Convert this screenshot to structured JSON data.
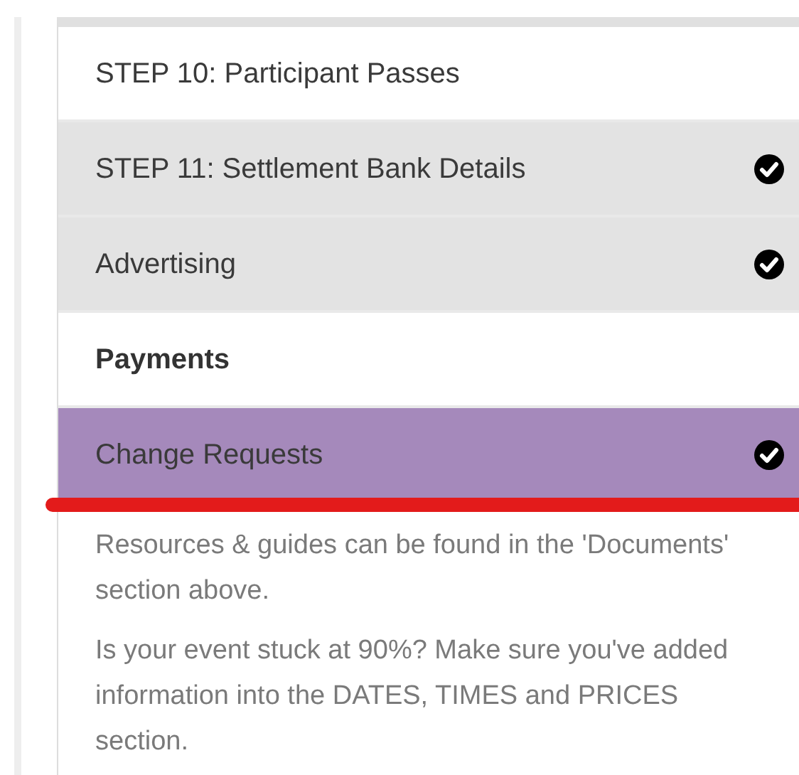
{
  "steps": [
    {
      "label": "STEP 10: Participant Passes",
      "kind": "step",
      "completed": false,
      "selected": false
    },
    {
      "label": "STEP 11: Settlement Bank Details",
      "kind": "step",
      "completed": true,
      "selected": false
    },
    {
      "label": "Advertising",
      "kind": "step",
      "completed": true,
      "selected": false
    },
    {
      "label": "Payments",
      "kind": "heading",
      "completed": false,
      "selected": false
    },
    {
      "label": "Change Requests",
      "kind": "step",
      "completed": true,
      "selected": true
    }
  ],
  "notes": [
    "Resources & guides can be found in the 'Documents' section above.",
    "Is your event stuck at 90%? Make sure you've added information into the DATES, TIMES and PRICES section."
  ]
}
